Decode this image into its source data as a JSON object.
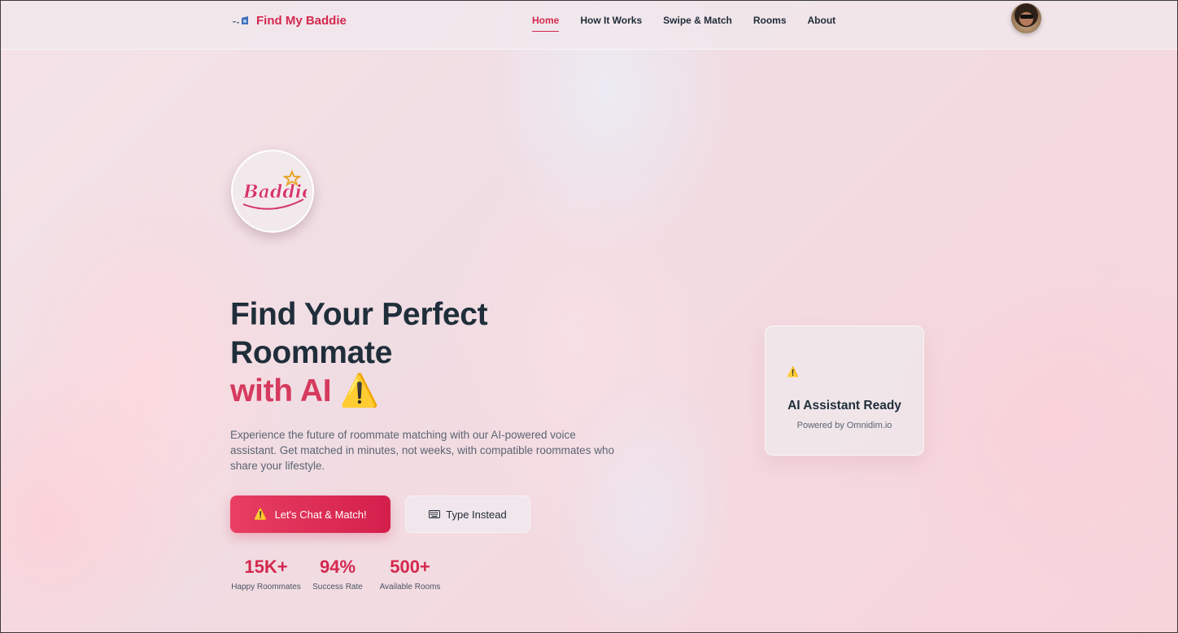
{
  "nav": {
    "brand": "Find My Baddie",
    "links": [
      {
        "label": "Home",
        "active": true
      },
      {
        "label": "How It Works",
        "active": false
      },
      {
        "label": "Swipe & Match",
        "active": false
      },
      {
        "label": "Rooms",
        "active": false
      },
      {
        "label": "About",
        "active": false
      }
    ]
  },
  "logo": {
    "text": "Baddie"
  },
  "hero": {
    "title_line1": "Find Your Perfect",
    "title_line2": "Roommate",
    "title_accent": "with AI ⚠️",
    "description": "Experience the future of roommate matching with our AI-powered voice assistant. Get matched in minutes, not weeks, with compatible roommates who share your lifestyle.",
    "primary_button": {
      "icon": "⚠️",
      "label": "Let's Chat & Match!"
    },
    "secondary_button": {
      "label": "Type Instead"
    }
  },
  "stats": [
    {
      "value": "15K+",
      "label": "Happy Roommates"
    },
    {
      "value": "94%",
      "label": "Success Rate"
    },
    {
      "value": "500+",
      "label": "Available Rooms"
    }
  ],
  "assistant_card": {
    "icon": "⚠️",
    "title": "AI Assistant Ready",
    "subtitle": "Powered by Omnidim.io"
  },
  "colors": {
    "accent": "#d4284f",
    "heading": "#1f2e3a",
    "body_text": "#5b6472"
  }
}
